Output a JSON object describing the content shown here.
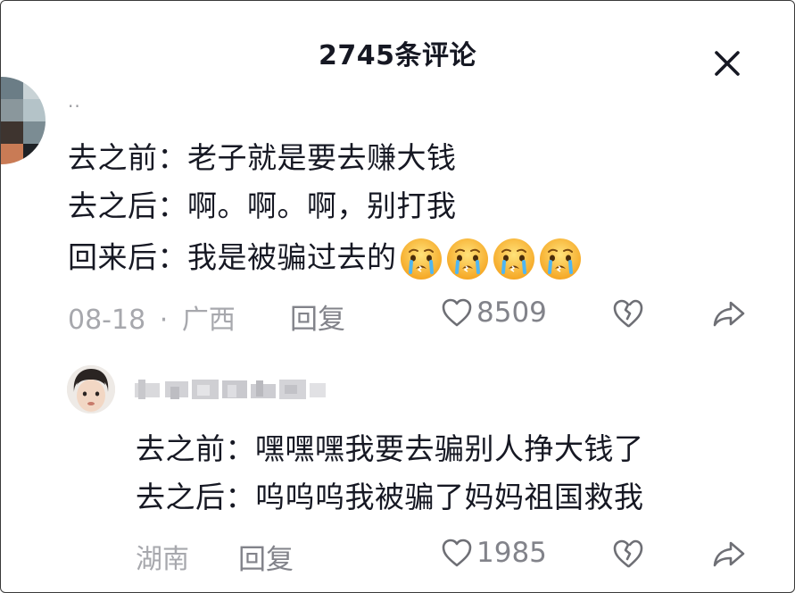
{
  "header": {
    "title": "2745条评论"
  },
  "comment1": {
    "username": "..",
    "lines": [
      "去之前：老子就是要去赚大钱",
      "去之后：啊。啊。啊，别打我",
      "回来后：我是被骗过去的"
    ],
    "emoji_icons": [
      "crying-face-icon",
      "crying-face-icon",
      "crying-face-icon",
      "crying-face-icon"
    ],
    "date": "08-18",
    "dot": "·",
    "location": "广西",
    "reply_label": "回复",
    "like_count": "8509"
  },
  "reply1": {
    "username_obscured": true,
    "lines": [
      "去之前：嘿嘿嘿我要去骗别人挣大钱了",
      "去之后：呜呜呜我被骗了妈妈祖国救我"
    ],
    "location": "湖南",
    "reply_label": "回复",
    "like_count": "1985"
  },
  "colors": {
    "primary_text": "#161823",
    "secondary_text": "#82838a",
    "meta_text": "#a7a8ad",
    "icon_stroke": "#6e6f75"
  }
}
